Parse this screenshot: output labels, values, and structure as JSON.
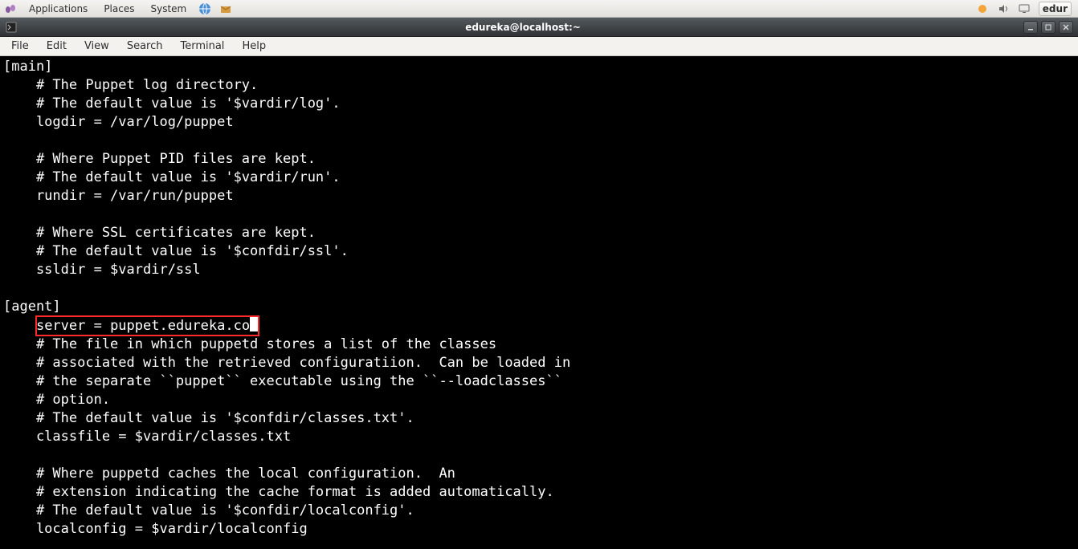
{
  "panel": {
    "menus": {
      "applications": "Applications",
      "places": "Places",
      "system": "System"
    },
    "user": "edur"
  },
  "window": {
    "title": "edureka@localhost:~",
    "menubar": {
      "file": "File",
      "edit": "Edit",
      "view": "View",
      "search": "Search",
      "terminal": "Terminal",
      "help": "Help"
    }
  },
  "terminal": {
    "l01": "[main]",
    "l02": "    # The Puppet log directory.",
    "l03": "    # The default value is '$vardir/log'.",
    "l04": "    logdir = /var/log/puppet",
    "l05": "",
    "l06": "    # Where Puppet PID files are kept.",
    "l07": "    # The default value is '$vardir/run'.",
    "l08": "    rundir = /var/run/puppet",
    "l09": "",
    "l10": "    # Where SSL certificates are kept.",
    "l11": "    # The default value is '$confdir/ssl'.",
    "l12": "    ssldir = $vardir/ssl",
    "l13": "",
    "l14": "[agent]",
    "l15_indent": "    ",
    "l15_hl": "server = puppet.edureka.co",
    "l16": "    # The file in which puppetd stores a list of the classes",
    "l17": "    # associated with the retrieved configuratiion.  Can be loaded in",
    "l18": "    # the separate ``puppet`` executable using the ``--loadclasses``",
    "l19": "    # option.",
    "l20": "    # The default value is '$confdir/classes.txt'.",
    "l21": "    classfile = $vardir/classes.txt",
    "l22": "",
    "l23": "    # Where puppetd caches the local configuration.  An",
    "l24": "    # extension indicating the cache format is added automatically.",
    "l25": "    # The default value is '$confdir/localconfig'.",
    "l26": "    localconfig = $vardir/localconfig"
  }
}
